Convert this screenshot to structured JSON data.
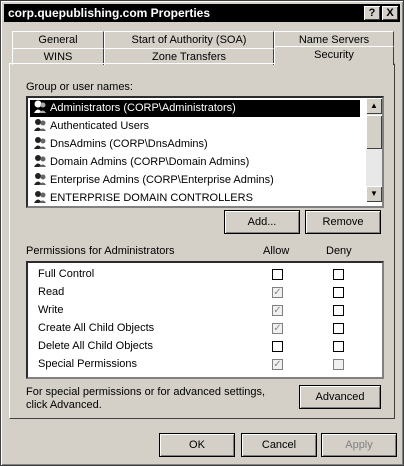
{
  "window": {
    "title": "corp.quepublishing.com Properties",
    "help_label": "?",
    "close_label": "X"
  },
  "tabs_row1": [
    "General",
    "Start of Authority (SOA)",
    "Name Servers"
  ],
  "tabs_row2": [
    "WINS",
    "Zone Transfers",
    "Security"
  ],
  "active_tab": "Security",
  "security": {
    "group_label": "Group or user names:",
    "users": [
      {
        "label": "Administrators (CORP\\Administrators)",
        "selected": true
      },
      {
        "label": "Authenticated Users",
        "selected": false
      },
      {
        "label": "DnsAdmins (CORP\\DnsAdmins)",
        "selected": false
      },
      {
        "label": "Domain Admins (CORP\\Domain Admins)",
        "selected": false
      },
      {
        "label": "Enterprise Admins (CORP\\Enterprise Admins)",
        "selected": false
      },
      {
        "label": "ENTERPRISE DOMAIN CONTROLLERS",
        "selected": false
      }
    ],
    "add_label": "Add...",
    "remove_label": "Remove",
    "permissions_label": "Permissions for Administrators",
    "allow_label": "Allow",
    "deny_label": "Deny",
    "permissions": [
      {
        "name": "Full Control",
        "allow": false,
        "allow_disabled": false,
        "deny": false,
        "deny_disabled": false
      },
      {
        "name": "Read",
        "allow": true,
        "allow_disabled": true,
        "deny": false,
        "deny_disabled": false
      },
      {
        "name": "Write",
        "allow": true,
        "allow_disabled": true,
        "deny": false,
        "deny_disabled": false
      },
      {
        "name": "Create All Child Objects",
        "allow": true,
        "allow_disabled": true,
        "deny": false,
        "deny_disabled": false
      },
      {
        "name": "Delete All Child Objects",
        "allow": false,
        "allow_disabled": false,
        "deny": false,
        "deny_disabled": false
      },
      {
        "name": "Special Permissions",
        "allow": true,
        "allow_disabled": true,
        "deny": false,
        "deny_disabled": true
      }
    ],
    "advanced_text_line1": "For special permissions or for advanced settings,",
    "advanced_text_line2": "click Advanced.",
    "advanced_label": "Advanced"
  },
  "footer": {
    "ok_label": "OK",
    "cancel_label": "Cancel",
    "apply_label": "Apply"
  },
  "icons": {
    "user_icon": "user-group-icon",
    "scroll_up": "scroll-up-icon",
    "scroll_down": "scroll-down-icon"
  }
}
